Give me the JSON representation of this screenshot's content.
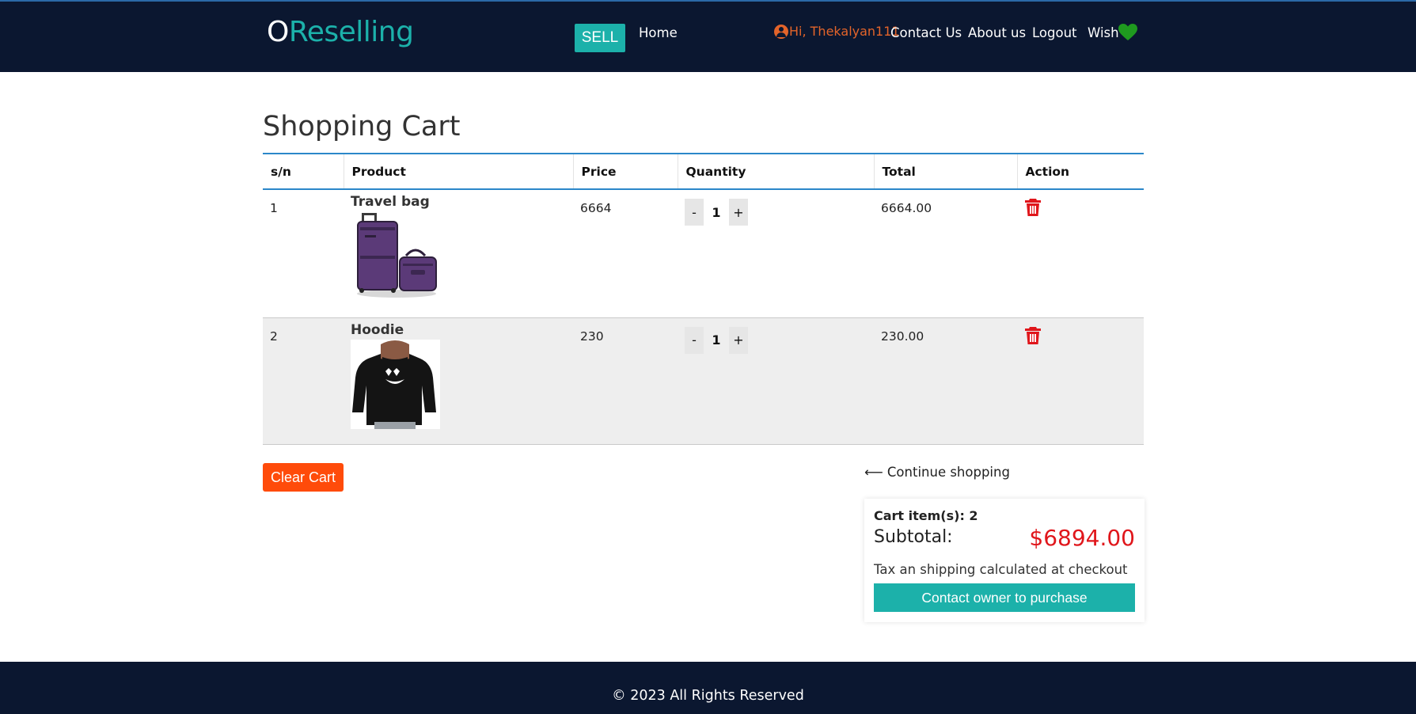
{
  "header": {
    "logo_first": "O",
    "logo_rest": "Reselling",
    "sell_label": "SELL",
    "nav": {
      "home": "Home",
      "greeting": "Hi, Thekalyan111",
      "contact": "Contact Us",
      "about": "About us",
      "logout": "Logout",
      "wish": "Wish"
    }
  },
  "page_title": "Shopping Cart",
  "table": {
    "headers": [
      "s/n",
      "Product",
      "Price",
      "Quantity",
      "Total",
      "Action"
    ],
    "rows": [
      {
        "sn": "1",
        "product": "Travel bag",
        "image": "purple-luggage-set",
        "price": "6664",
        "quantity": "1",
        "total": "6664.00",
        "minus": "-",
        "plus": "+"
      },
      {
        "sn": "2",
        "product": "Hoodie",
        "image": "black-marshmello-hoodie",
        "price": "230",
        "quantity": "1",
        "total": "230.00",
        "minus": "-",
        "plus": "+"
      }
    ]
  },
  "clear_cart_label": "Clear Cart",
  "continue_shopping_label": "⟵ Continue shopping",
  "summary": {
    "items_label": "Cart item(s): 2",
    "subtotal_label": "Subtotal:",
    "subtotal_value": "$6894.00",
    "tax_note": "Tax an shipping calculated at checkout",
    "contact_label": "Contact owner to purchase"
  },
  "footer": {
    "copyright": "© 2023 All Rights Reserved"
  },
  "colors": {
    "navbar": "#0b1730",
    "teal": "#1cb1aa",
    "orange": "#ff4b0a",
    "greeting": "#e3642a",
    "subtotal": "#e0161b",
    "trash": "#e0161b",
    "heart": "#1f9a1f"
  }
}
